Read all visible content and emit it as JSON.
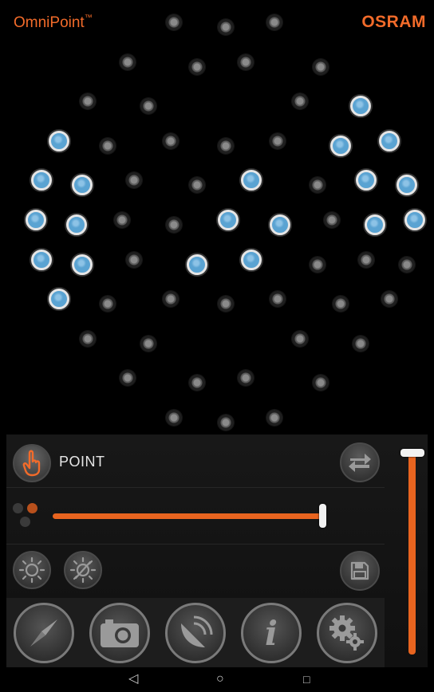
{
  "brand": {
    "product": "OmniPoint",
    "trademark": "™",
    "company": "OSRAM"
  },
  "colors": {
    "accent": "#e8641f",
    "led_on": "#5aa3d2",
    "led_off": "#5d5d5d",
    "panel": "#141414"
  },
  "led_grid": {
    "columns": 14,
    "state_legend": {
      "on": "lit",
      "off": "dark"
    },
    "rows": [
      {
        "leds": [
          {
            "col": 5.5,
            "on": false
          },
          {
            "col": 7.3,
            "on": false
          },
          {
            "col": 9.0,
            "on": false
          }
        ]
      },
      {
        "leds": [
          {
            "col": 3.9,
            "on": false
          },
          {
            "col": 6.3,
            "on": false
          },
          {
            "col": 8.0,
            "on": false
          },
          {
            "col": 10.6,
            "on": false
          }
        ]
      },
      {
        "leds": [
          {
            "col": 2.5,
            "on": false
          },
          {
            "col": 4.6,
            "on": false
          },
          {
            "col": 9.9,
            "on": false
          },
          {
            "col": 12.0,
            "on": true
          }
        ]
      },
      {
        "leds": [
          {
            "col": 1.5,
            "on": true
          },
          {
            "col": 3.2,
            "on": false
          },
          {
            "col": 5.4,
            "on": false
          },
          {
            "col": 7.3,
            "on": false
          },
          {
            "col": 9.1,
            "on": false
          },
          {
            "col": 11.3,
            "on": true
          },
          {
            "col": 13.0,
            "on": true
          }
        ]
      },
      {
        "leds": [
          {
            "col": 0.9,
            "on": true
          },
          {
            "col": 2.3,
            "on": true
          },
          {
            "col": 4.1,
            "on": false
          },
          {
            "col": 6.3,
            "on": false
          },
          {
            "col": 8.2,
            "on": true
          },
          {
            "col": 10.5,
            "on": false
          },
          {
            "col": 12.2,
            "on": true
          },
          {
            "col": 13.6,
            "on": true
          }
        ]
      },
      {
        "leds": [
          {
            "col": 0.7,
            "on": true
          },
          {
            "col": 2.1,
            "on": true
          },
          {
            "col": 3.7,
            "on": false
          },
          {
            "col": 5.5,
            "on": false
          },
          {
            "col": 7.4,
            "on": true
          },
          {
            "col": 9.2,
            "on": true
          },
          {
            "col": 11.0,
            "on": false
          },
          {
            "col": 12.5,
            "on": true
          },
          {
            "col": 13.9,
            "on": true
          }
        ]
      },
      {
        "leds": [
          {
            "col": 0.9,
            "on": true
          },
          {
            "col": 2.3,
            "on": true
          },
          {
            "col": 4.1,
            "on": false
          },
          {
            "col": 6.3,
            "on": true
          },
          {
            "col": 8.2,
            "on": true
          },
          {
            "col": 10.5,
            "on": false
          },
          {
            "col": 12.2,
            "on": false
          },
          {
            "col": 13.6,
            "on": false
          }
        ]
      },
      {
        "leds": [
          {
            "col": 1.5,
            "on": true
          },
          {
            "col": 3.2,
            "on": false
          },
          {
            "col": 5.4,
            "on": false
          },
          {
            "col": 7.3,
            "on": false
          },
          {
            "col": 9.1,
            "on": false
          },
          {
            "col": 11.3,
            "on": false
          },
          {
            "col": 13.0,
            "on": false
          }
        ]
      },
      {
        "leds": [
          {
            "col": 2.5,
            "on": false
          },
          {
            "col": 4.6,
            "on": false
          },
          {
            "col": 9.9,
            "on": false
          },
          {
            "col": 12.0,
            "on": false
          }
        ]
      },
      {
        "leds": [
          {
            "col": 3.9,
            "on": false
          },
          {
            "col": 6.3,
            "on": false
          },
          {
            "col": 8.0,
            "on": false
          },
          {
            "col": 10.6,
            "on": false
          }
        ]
      },
      {
        "leds": [
          {
            "col": 5.5,
            "on": false
          },
          {
            "col": 7.3,
            "on": false
          },
          {
            "col": 9.0,
            "on": false
          }
        ]
      }
    ]
  },
  "mode": {
    "label": "POINT",
    "icon": "hand-point-icon"
  },
  "spread_slider": {
    "value_percent": 100,
    "icon": "dot-cluster-icon"
  },
  "brightness_slider": {
    "value_percent": 100
  },
  "tools": {
    "swap_icon": "swap-arrows-icon",
    "light_on_icon": "light-on-icon",
    "light_off_icon": "light-off-icon",
    "save_icon": "floppy-disk-icon"
  },
  "nav": {
    "items": [
      {
        "icon": "compass-icon"
      },
      {
        "icon": "camera-icon"
      },
      {
        "icon": "satellite-dish-icon"
      },
      {
        "icon": "info-icon",
        "glyph": "i"
      },
      {
        "icon": "gears-icon"
      }
    ]
  },
  "system_nav": {
    "back": "◁",
    "home": "○",
    "recents": "□"
  }
}
